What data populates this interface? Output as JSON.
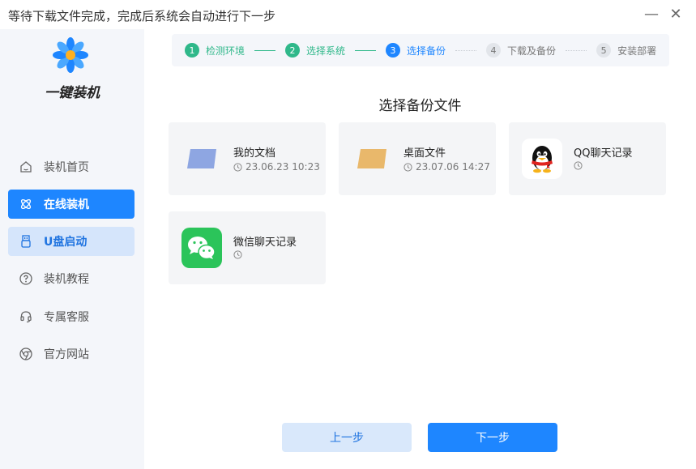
{
  "window": {
    "title": "等待下载文件完成，完成后系统会自动进行下一步",
    "minimize_glyph": "—",
    "close_glyph": "✕"
  },
  "brand": {
    "name": "一键装机"
  },
  "sidebar": {
    "items": [
      {
        "label": "装机首页",
        "icon": "home-icon"
      },
      {
        "label": "在线装机",
        "icon": "atom-icon"
      },
      {
        "label": "U盘启动",
        "icon": "usb-icon"
      },
      {
        "label": "装机教程",
        "icon": "help-icon"
      },
      {
        "label": "专属客服",
        "icon": "headset-icon"
      },
      {
        "label": "官方网站",
        "icon": "browser-icon"
      }
    ]
  },
  "steps": [
    {
      "num": "1",
      "label": "检测环境",
      "state": "done"
    },
    {
      "num": "2",
      "label": "选择系统",
      "state": "done"
    },
    {
      "num": "3",
      "label": "选择备份",
      "state": "current"
    },
    {
      "num": "4",
      "label": "下载及备份",
      "state": "todo"
    },
    {
      "num": "5",
      "label": "安装部署",
      "state": "todo"
    }
  ],
  "section_title": "选择备份文件",
  "cards": [
    {
      "name": "我的文档",
      "time": "23.06.23 10:23",
      "icon": "folder-blue-icon"
    },
    {
      "name": "桌面文件",
      "time": "23.07.06 14:27",
      "icon": "folder-orange-icon"
    },
    {
      "name": "QQ聊天记录",
      "time": "",
      "icon": "qq-icon"
    },
    {
      "name": "微信聊天记录",
      "time": "",
      "icon": "wechat-icon"
    }
  ],
  "buttons": {
    "prev": "上一步",
    "next": "下一步"
  },
  "colors": {
    "accent": "#1e86ff",
    "done": "#2fb88a",
    "sidebar_bg": "#f4f6fa",
    "wechat": "#2bc45a"
  }
}
